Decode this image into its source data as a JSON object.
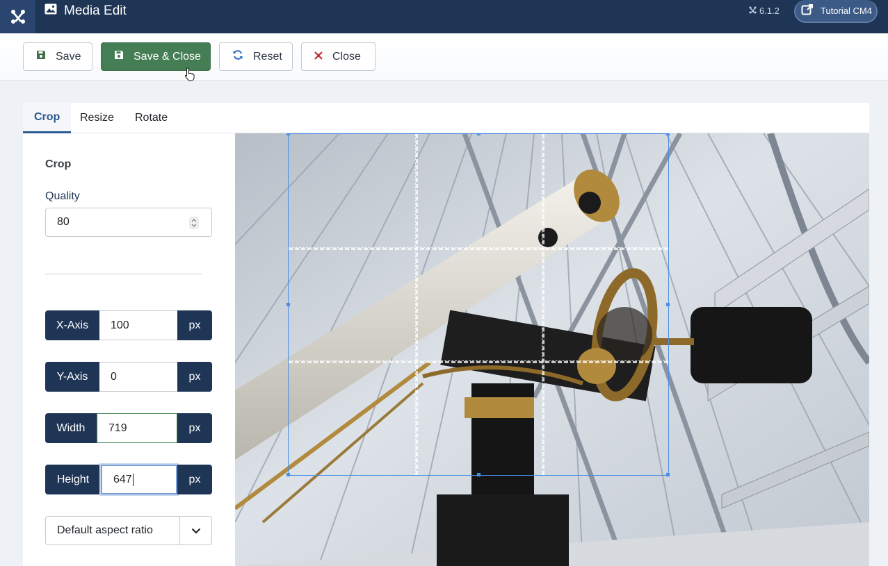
{
  "header": {
    "title": "Media Edit",
    "version": "6.1.2",
    "site_button": "Tutorial CM4"
  },
  "toolbar": {
    "save": "Save",
    "save_close": "Save & Close",
    "reset": "Reset",
    "close": "Close"
  },
  "tabs": [
    {
      "label": "Crop",
      "active": true
    },
    {
      "label": "Resize",
      "active": false
    },
    {
      "label": "Rotate",
      "active": false
    }
  ],
  "crop_panel": {
    "title": "Crop",
    "quality_label": "Quality",
    "quality_value": "80",
    "fields": [
      {
        "label": "X-Axis",
        "value": "100",
        "unit": "px"
      },
      {
        "label": "Y-Axis",
        "value": "0",
        "unit": "px"
      },
      {
        "label": "Width",
        "value": "719",
        "unit": "px"
      },
      {
        "label": "Height",
        "value": "647",
        "unit": "px"
      }
    ],
    "aspect_ratio": "Default aspect ratio"
  },
  "colors": {
    "header": "#1f3556",
    "primary_button": "#457d54",
    "active_tab": "#2a5a92",
    "crop_border": "#4a8ee6"
  },
  "icons": [
    "joomla-logo-icon",
    "image-icon",
    "joomla-version-icon",
    "external-link-icon",
    "floppy-disk-icon",
    "refresh-icon",
    "close-x-icon",
    "spinner-icon",
    "chevron-down-icon",
    "pointer-cursor-icon"
  ]
}
